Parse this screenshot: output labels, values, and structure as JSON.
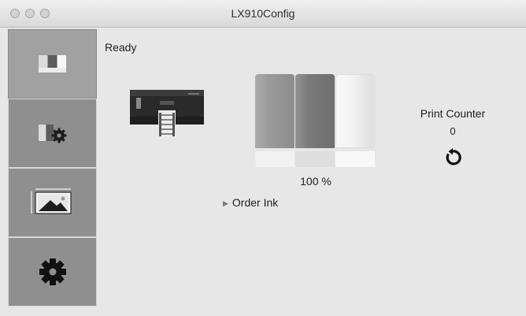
{
  "window": {
    "title": "LX910Config"
  },
  "sidebar": {
    "items": [
      {
        "name": "ink-status",
        "icon": "ink-cartridges-icon",
        "active": true
      },
      {
        "name": "ink-settings",
        "icon": "cartridge-gear-icon",
        "active": false
      },
      {
        "name": "print-alignment",
        "icon": "image-alignment-icon",
        "active": false
      },
      {
        "name": "settings",
        "icon": "gear-icon",
        "active": false
      }
    ]
  },
  "main": {
    "status": "Ready",
    "ink": {
      "percent_label": "100 %",
      "cartridge_colors": [
        "#9a9a9a",
        "#7a7a7a",
        "#f5f5f5"
      ]
    },
    "order_ink_label": "Order Ink",
    "print_counter": {
      "label": "Print Counter",
      "value": "0",
      "reset_icon": "reset-icon"
    }
  }
}
